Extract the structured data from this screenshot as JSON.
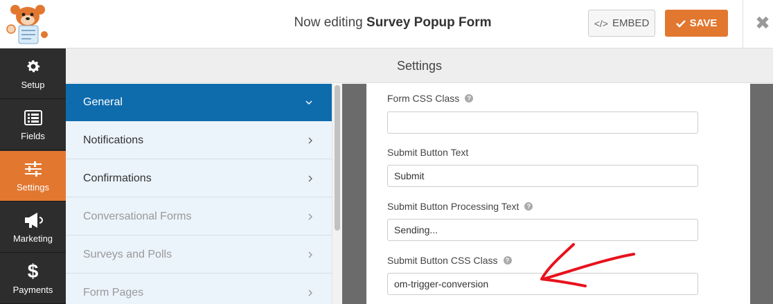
{
  "header": {
    "title_prefix": "Now editing ",
    "form_name": "Survey Popup Form",
    "embed_label": "EMBED",
    "save_label": "SAVE",
    "close_glyph": "✖"
  },
  "leftnav": {
    "items": [
      {
        "label": "Setup",
        "icon": "gear-icon"
      },
      {
        "label": "Fields",
        "icon": "list-icon"
      },
      {
        "label": "Settings",
        "icon": "sliders-icon",
        "active": true
      },
      {
        "label": "Marketing",
        "icon": "megaphone-icon"
      },
      {
        "label": "Payments",
        "icon": "dollar-icon"
      }
    ]
  },
  "settings": {
    "title": "Settings",
    "menu": [
      {
        "label": "General",
        "active": true
      },
      {
        "label": "Notifications"
      },
      {
        "label": "Confirmations"
      },
      {
        "label": "Conversational Forms",
        "disabled": true
      },
      {
        "label": "Surveys and Polls",
        "disabled": true
      },
      {
        "label": "Form Pages",
        "disabled": true
      }
    ]
  },
  "fields": {
    "form_css_class": {
      "label": "Form CSS Class",
      "value": ""
    },
    "submit_text": {
      "label": "Submit Button Text",
      "value": "Submit"
    },
    "processing_text": {
      "label": "Submit Button Processing Text",
      "value": "Sending..."
    },
    "submit_css_class": {
      "label": "Submit Button CSS Class",
      "value": "om-trigger-conversion"
    }
  },
  "colors": {
    "accent_orange": "#e27730",
    "active_blue": "#0e6cad",
    "nav_dark": "#2d2d2d",
    "annotation_red": "#e8121d"
  }
}
